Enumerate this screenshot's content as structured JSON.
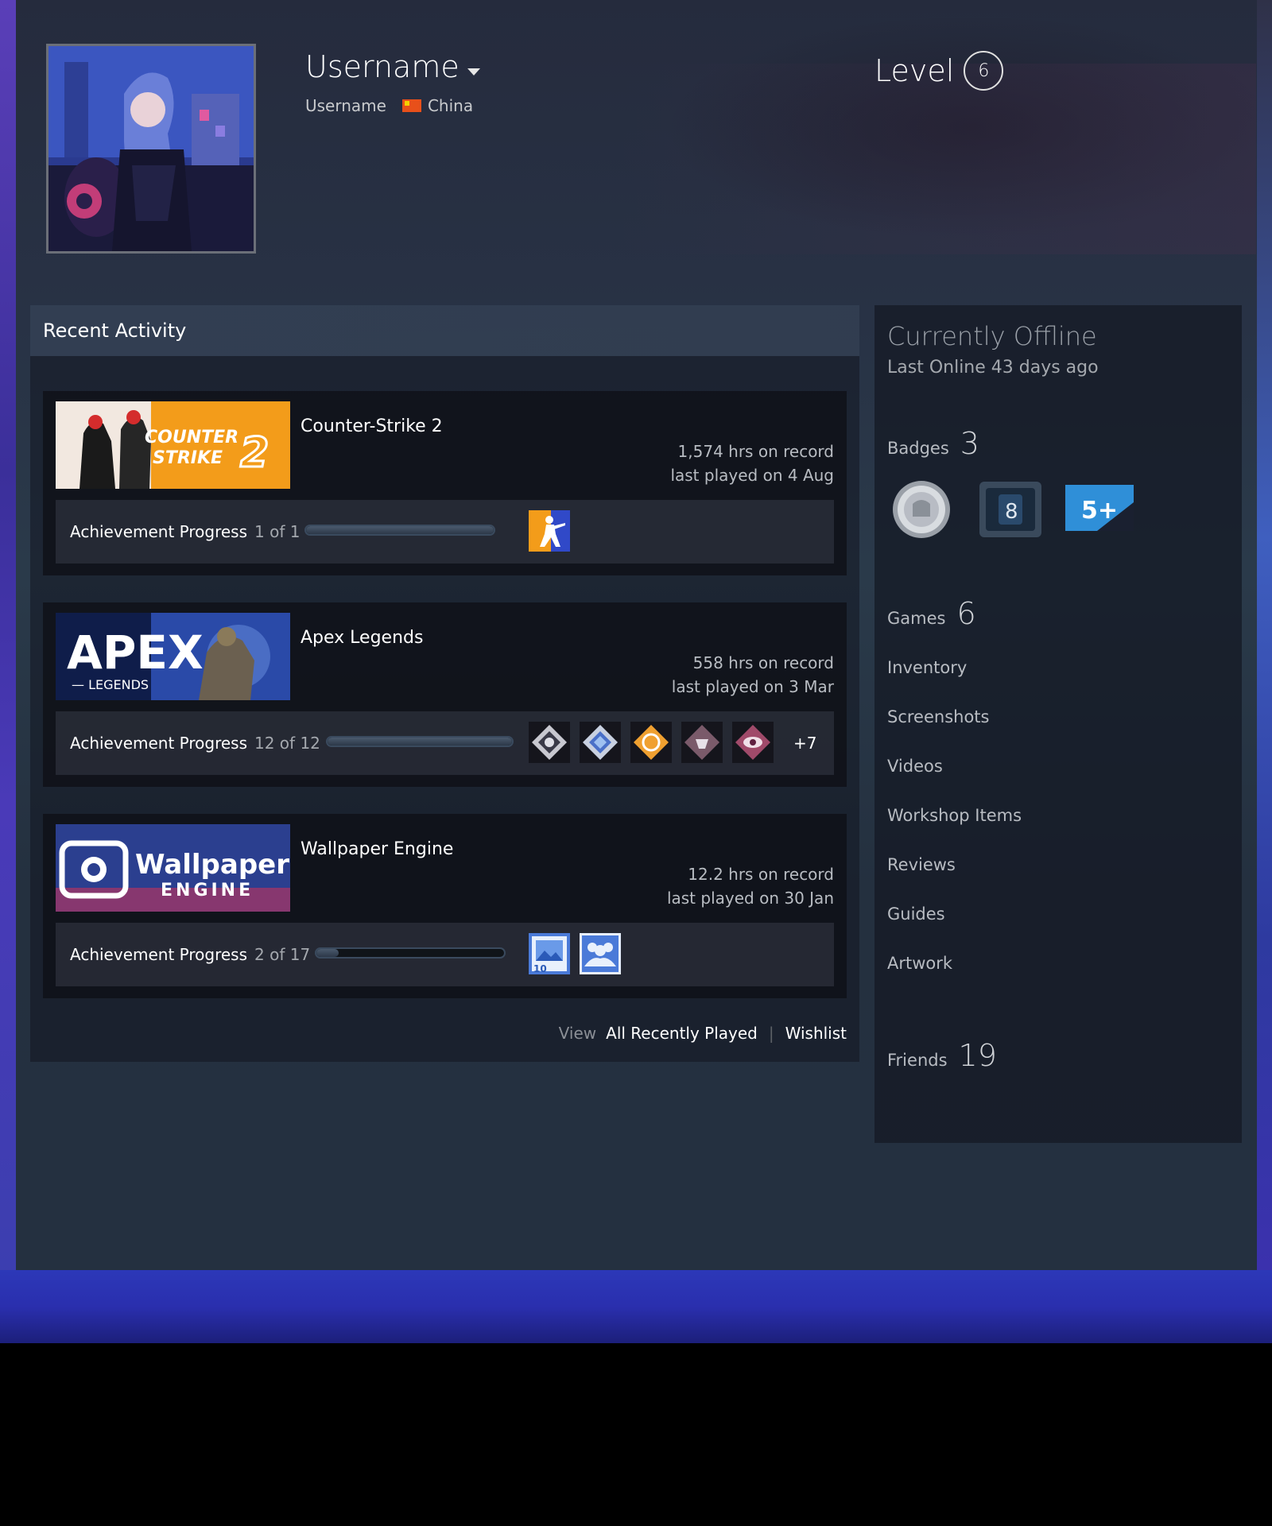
{
  "profile": {
    "persona_name": "Username",
    "real_name": "Username",
    "country": "China",
    "level_label": "Level",
    "level": "6"
  },
  "recent_activity": {
    "title": "Recent Activity",
    "games": [
      {
        "name": "Counter-Strike 2",
        "hours": "1,574 hrs on record",
        "last_played": "last played on 4 Aug",
        "achievement_label": "Achievement Progress",
        "achievement_count": "1 of 1",
        "achievement_progress": 1.0,
        "capsule_text": [
          "COUNTER",
          "STRIKE",
          "2"
        ],
        "icons": [
          "cs-soldier-icon"
        ]
      },
      {
        "name": "Apex Legends",
        "hours": "558 hrs on record",
        "last_played": "last played on 3 Mar",
        "achievement_label": "Achievement Progress",
        "achievement_count": "12 of 12",
        "achievement_progress": 1.0,
        "capsule_text": [
          "APEX",
          "— LEGENDS"
        ],
        "icons": [
          "apex-achievement-1-icon",
          "apex-achievement-2-icon",
          "apex-achievement-3-icon",
          "apex-achievement-4-icon",
          "apex-achievement-5-icon"
        ],
        "more": "+7"
      },
      {
        "name": "Wallpaper Engine",
        "hours": "12.2 hrs on record",
        "last_played": "last played on 30 Jan",
        "achievement_label": "Achievement Progress",
        "achievement_count": "2 of 17",
        "achievement_progress": 0.118,
        "capsule_text": [
          "Wallpaper",
          "ENGINE"
        ],
        "icons": [
          "wallpaper-image-icon",
          "wallpaper-community-icon"
        ],
        "icon_text": "10"
      }
    ],
    "footer": {
      "view_label": "View",
      "all_recently_played": "All Recently Played",
      "separator": "|",
      "wishlist": "Wishlist"
    }
  },
  "sidebar": {
    "status": "Currently Offline",
    "last_online": "Last Online 43 days ago",
    "badges_label": "Badges",
    "badges_count": "3",
    "badge_texts": [
      "8",
      "5+"
    ],
    "games_label": "Games",
    "games_count": "6",
    "links": [
      "Inventory",
      "Screenshots",
      "Videos",
      "Workshop Items",
      "Reviews",
      "Guides",
      "Artwork"
    ],
    "friends_label": "Friends",
    "friends_count": "19"
  },
  "colors": {
    "page_bg": "#252b3d",
    "accent_orange": "#f39c12",
    "accent_blue": "#3a6fd8",
    "text_primary": "#ffffff",
    "text_muted": "#b8bcc2"
  }
}
